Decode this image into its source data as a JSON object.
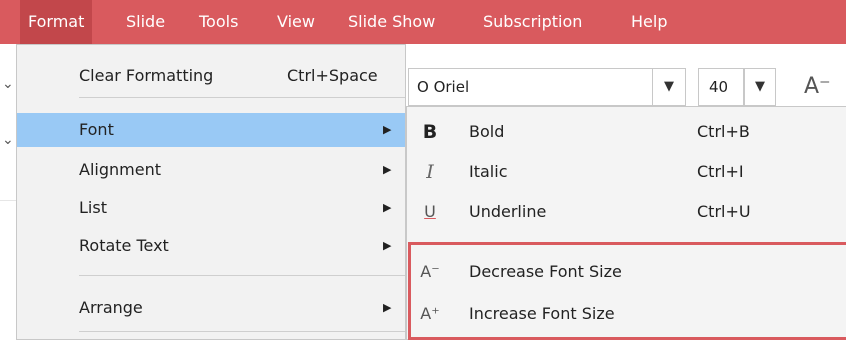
{
  "menubar": {
    "items": [
      {
        "label": "Format",
        "active": true
      },
      {
        "label": "Slide"
      },
      {
        "label": "Tools"
      },
      {
        "label": "View"
      },
      {
        "label": "Slide Show"
      },
      {
        "label": "Subscription"
      },
      {
        "label": "Help"
      }
    ]
  },
  "toolbar": {
    "font_name": "O Oriel",
    "font_size": "40",
    "font_dropdown_icon": "chevron-down-icon",
    "size_dropdown_icon": "chevron-down-icon",
    "decrease_icon": "A⁻"
  },
  "format_menu": {
    "items": [
      {
        "label": "Clear Formatting",
        "shortcut": "Ctrl+Space"
      },
      {
        "label": "Font",
        "submenu": true,
        "selected": true
      },
      {
        "label": "Alignment",
        "submenu": true
      },
      {
        "label": "List",
        "submenu": true
      },
      {
        "label": "Rotate Text",
        "submenu": true
      },
      {
        "label": "Arrange",
        "submenu": true
      }
    ]
  },
  "font_submenu": {
    "items": [
      {
        "icon": "B",
        "label": "Bold",
        "shortcut": "Ctrl+B"
      },
      {
        "icon": "I",
        "label": "Italic",
        "shortcut": "Ctrl+I"
      },
      {
        "icon": "U",
        "label": "Underline",
        "shortcut": "Ctrl+U"
      },
      {
        "icon": "A⁻",
        "label": "Decrease Font Size"
      },
      {
        "icon": "A⁺",
        "label": "Increase Font Size"
      }
    ]
  },
  "colors": {
    "menubar": "#d95a5e",
    "menubar_active": "#c2474b",
    "selection": "#99c9f5",
    "highlight_border": "#d95a5e"
  }
}
